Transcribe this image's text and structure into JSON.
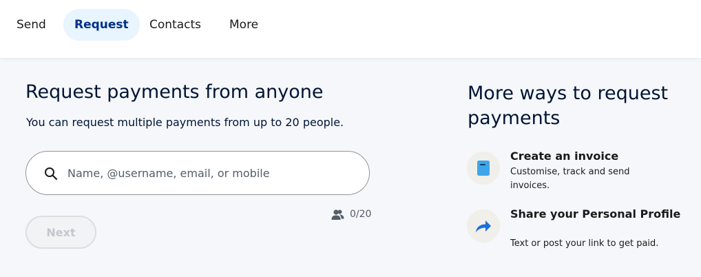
{
  "nav": {
    "tabs": [
      {
        "label": "Send"
      },
      {
        "label": "Request"
      },
      {
        "label": "Contacts"
      },
      {
        "label": "More"
      }
    ],
    "active": "Request"
  },
  "main": {
    "title": "Request payments from anyone",
    "subtitle": "You can request multiple payments from up to 20 people.",
    "search": {
      "icon": "search-icon",
      "placeholder": "Name, @username, email, or mobile",
      "value": ""
    },
    "counter": {
      "icon": "people-icon",
      "text": "0/20"
    },
    "next_label": "Next"
  },
  "side": {
    "title": "More ways to request payments",
    "options": [
      {
        "icon": "invoice-icon",
        "title": "Create an invoice",
        "description": "Customise, track and send invoices."
      },
      {
        "icon": "share-arrow-icon",
        "title": "Share your Personal Profile",
        "description": "Text or post your link to get paid."
      }
    ]
  },
  "colors": {
    "accent": "#003087",
    "active_tab_bg": "#e8f4fe",
    "invoice_icon": "#3ea6e8",
    "share_icon": "#1a6fe0"
  }
}
